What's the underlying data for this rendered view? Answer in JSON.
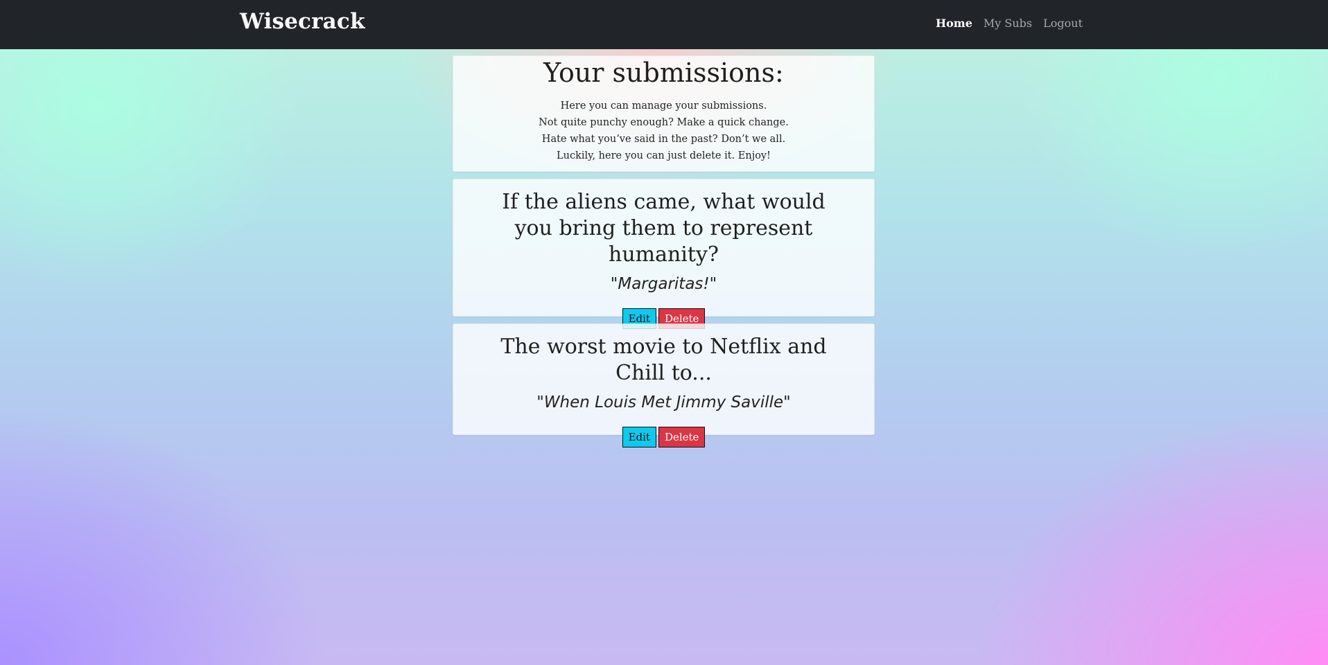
{
  "navbar": {
    "brand": "Wisecrack",
    "links": [
      {
        "label": "Home",
        "active": true
      },
      {
        "label": "My Subs",
        "active": false
      },
      {
        "label": "Logout",
        "active": false
      }
    ]
  },
  "intro": {
    "title": "Your submissions:",
    "lines": [
      "Here you can manage your submissions.",
      "Not quite punchy enough? Make a quick change.",
      "Hate what you’ve said in the past? Don’t we all.",
      "Luckily, here you can just delete it. Enjoy!"
    ]
  },
  "submissions": [
    {
      "prompt": "If the aliens came, what would you bring them to represent humanity?",
      "answer": "\"Margaritas!\"",
      "edit_label": "Edit",
      "delete_label": "Delete"
    },
    {
      "prompt": "The worst movie to Netflix and Chill to...",
      "answer": "\"When Louis Met Jimmy Saville\"",
      "edit_label": "Edit",
      "delete_label": "Delete"
    }
  ],
  "colors": {
    "navbar_bg": "#212529",
    "edit_button": "#0dcaf0",
    "delete_button": "#dc3545"
  }
}
